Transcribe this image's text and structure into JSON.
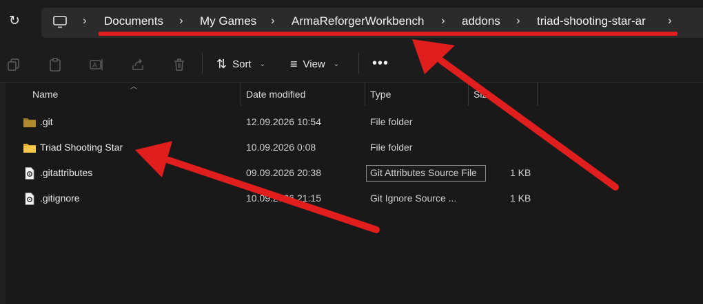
{
  "address_bar": {
    "breadcrumbs": [
      "Documents",
      "My Games",
      "ArmaReforgerWorkbench",
      "addons",
      "triad-shooting-star-ar"
    ],
    "separator": "›"
  },
  "toolbar": {
    "sort_label": "Sort",
    "view_label": "View",
    "more_label": "•••",
    "caret": "⌄"
  },
  "columns": {
    "name": "Name",
    "date_modified": "Date modified",
    "type": "Type",
    "size": "Size"
  },
  "files": [
    {
      "name": ".git",
      "date": "12.09.2026 10:54",
      "type": "File folder",
      "size": "",
      "icon": "folder-dim-icon"
    },
    {
      "name": "Triad Shooting Star",
      "date": "10.09.2026 0:08",
      "type": "File folder",
      "size": "",
      "icon": "folder-icon"
    },
    {
      "name": ".gitattributes",
      "date": "09.09.2026 20:38",
      "type": "Git Attributes Source File",
      "size": "1 KB",
      "icon": "settings-file-icon"
    },
    {
      "name": ".gitignore",
      "date": "10.09.2026 21:15",
      "type": "Git Ignore Source ...",
      "size": "1 KB",
      "icon": "settings-file-icon"
    }
  ],
  "colors": {
    "background": "#1c1c1c",
    "address_bar": "#2b2b2b",
    "annotation_red": "#e01e1e",
    "folder_yellow": "#f4c84a",
    "folder_dim": "#b08a2c"
  }
}
